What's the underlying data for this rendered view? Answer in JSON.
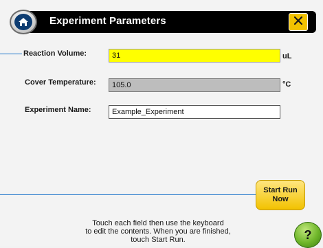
{
  "header": {
    "title": "Experiment Parameters",
    "home_icon": "home-icon",
    "close_icon": "close-icon"
  },
  "fields": {
    "reaction_volume": {
      "label": "Reaction Volume:",
      "value": "31",
      "unit": "uL"
    },
    "cover_temperature": {
      "label": "Cover Temperature:",
      "value": "105.0",
      "unit": "°C"
    },
    "experiment_name": {
      "label": "Experiment Name:",
      "value": "Example_Experiment"
    }
  },
  "actions": {
    "start_run_line1": "Start Run",
    "start_run_line2": "Now",
    "help_icon": "help-icon",
    "help_glyph": "?"
  },
  "instructions": {
    "line1": "Touch each field then use the keyboard",
    "line2": "to edit the contents. When you are finished,",
    "line3": "touch Start Run."
  },
  "colors": {
    "header_bg": "#000000",
    "accent_yellow": "#f2c200",
    "volume_highlight": "#ffff00",
    "readonly_gray": "#bdbdbd",
    "help_green": "#6fb62a",
    "leader_blue": "#1a73c9"
  }
}
